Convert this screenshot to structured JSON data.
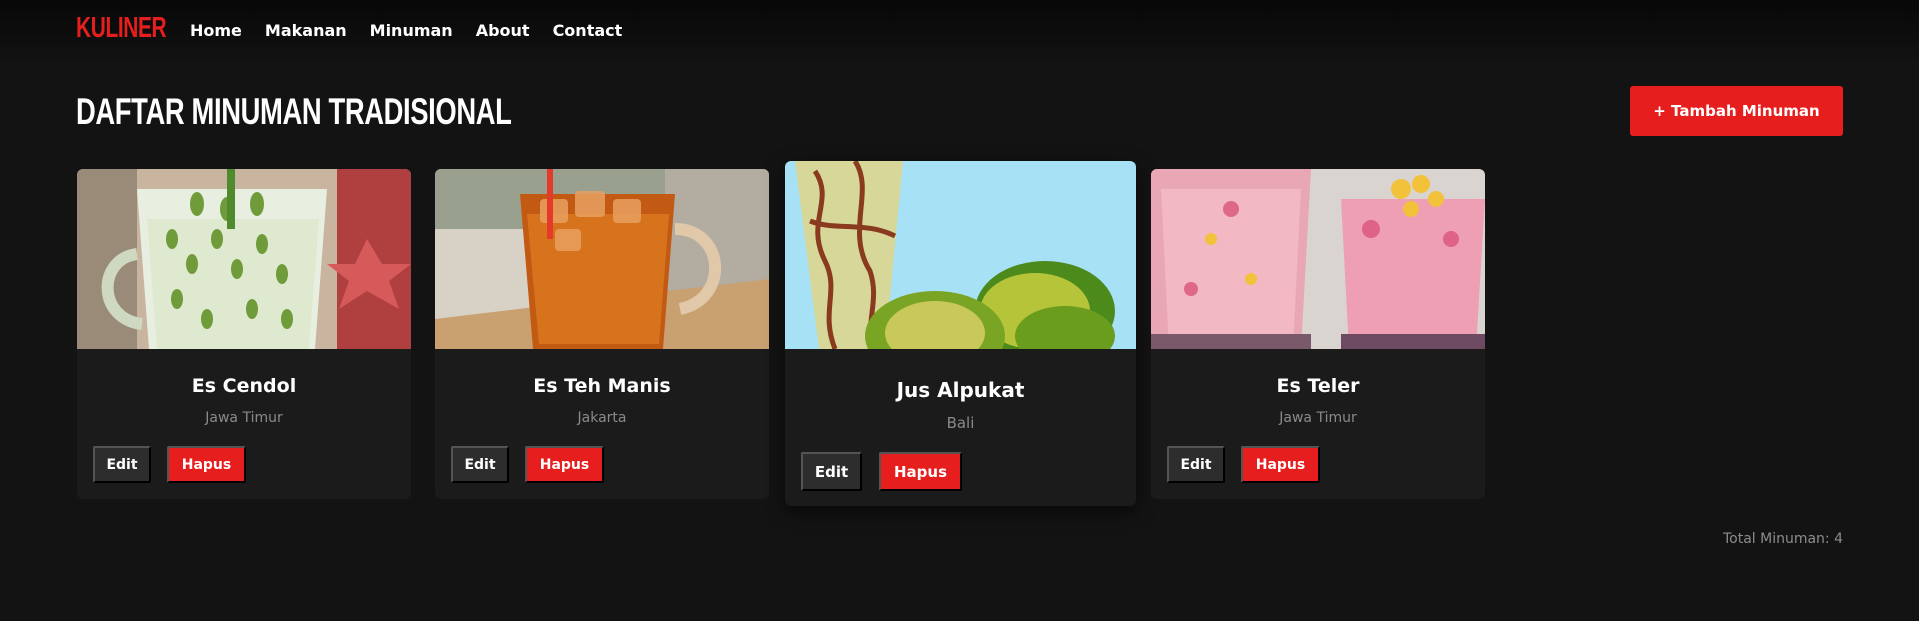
{
  "nav": {
    "brand": "KULINER",
    "links": [
      {
        "label": "Home"
      },
      {
        "label": "Makanan"
      },
      {
        "label": "Minuman"
      },
      {
        "label": "About"
      },
      {
        "label": "Contact"
      }
    ]
  },
  "page": {
    "title": "DAFTAR MINUMAN TRADISIONAL",
    "add_button": "+ Tambah Minuman"
  },
  "drinks": [
    {
      "name": "Es Cendol",
      "region": "Jawa Timur",
      "edit_label": "Edit",
      "delete_label": "Hapus"
    },
    {
      "name": "Es Teh Manis",
      "region": "Jakarta",
      "edit_label": "Edit",
      "delete_label": "Hapus"
    },
    {
      "name": "Jus Alpukat",
      "region": "Bali",
      "edit_label": "Edit",
      "delete_label": "Hapus"
    },
    {
      "name": "Es Teler",
      "region": "Jawa Timur",
      "edit_label": "Edit",
      "delete_label": "Hapus"
    }
  ],
  "footer": {
    "total": "Total Minuman: 4"
  },
  "colors": {
    "accent": "#e61e1e",
    "background": "#131313",
    "card": "#1b1b1b",
    "edit_button": "#2d2d2d",
    "muted_text": "#8a8a8a"
  }
}
